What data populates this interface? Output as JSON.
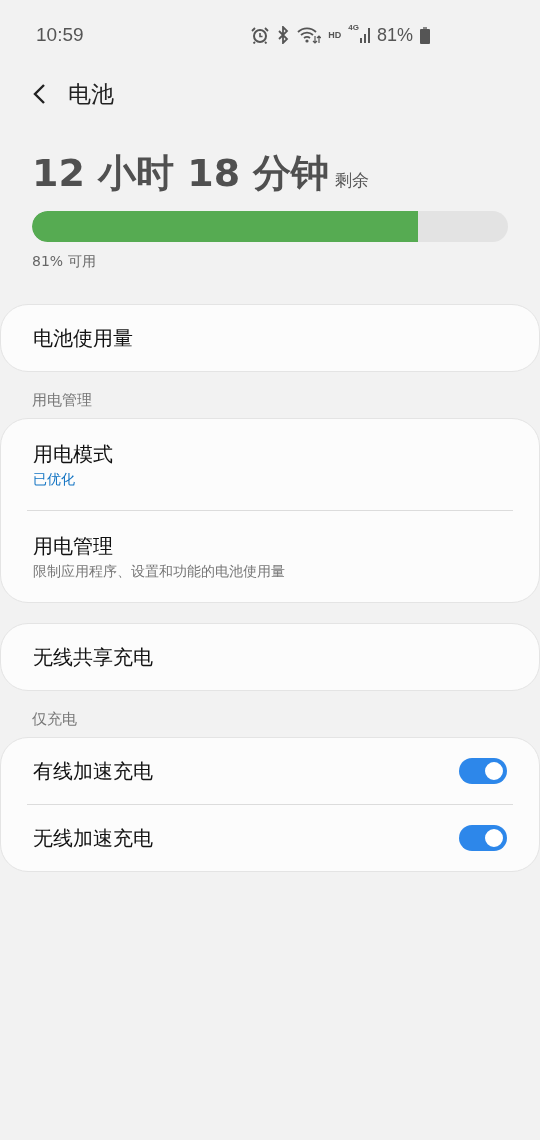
{
  "status_bar": {
    "time": "10:59",
    "hd": "HD",
    "network": "4G",
    "battery": "81%"
  },
  "header": {
    "title": "电池"
  },
  "summary": {
    "time_left": "12 小时 18 分钟",
    "remaining": "剩余",
    "level": 0.81,
    "available": "81% 可用"
  },
  "groups": [
    {
      "items": [
        {
          "kind": "link",
          "title": "电池使用量"
        }
      ]
    },
    {
      "title": "用电管理",
      "items": [
        {
          "kind": "link",
          "title": "用电模式",
          "subtitle": {
            "kind": "value",
            "text": "已优化"
          }
        },
        {
          "kind": "link",
          "title": "用电管理",
          "subtitle": {
            "kind": "hint",
            "text": "限制应用程序、设置和功能的电池使用量"
          }
        }
      ]
    },
    {
      "items": [
        {
          "kind": "link",
          "title": "无线共享充电"
        }
      ]
    },
    {
      "title": "仅充电",
      "items": [
        {
          "kind": "switch",
          "title": "有线加速充电",
          "on": true
        },
        {
          "kind": "switch",
          "title": "无线加速充电",
          "on": true
        }
      ]
    }
  ]
}
